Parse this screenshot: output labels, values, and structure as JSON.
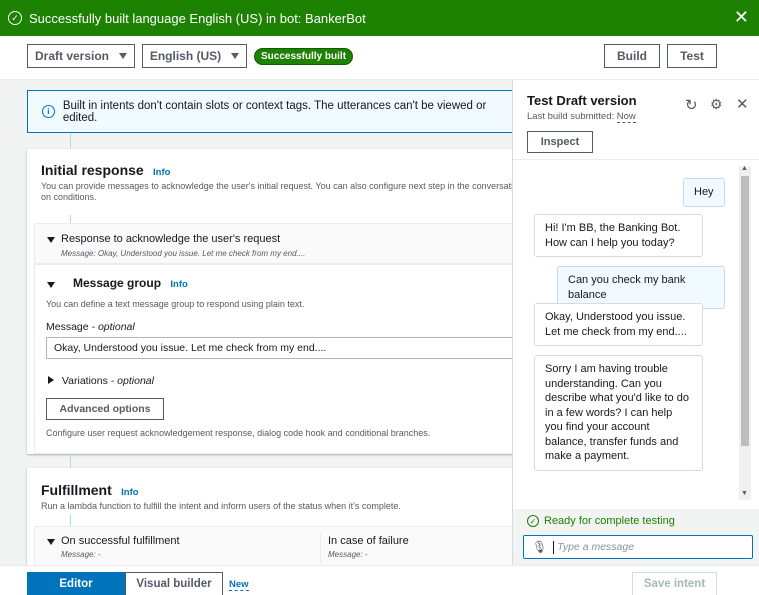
{
  "flash": {
    "message": "Successfully built language English (US) in bot: BankerBot"
  },
  "toolbar": {
    "version": "Draft version",
    "language": "English (US)",
    "status": "Successfully built",
    "build_label": "Build",
    "test_label": "Test"
  },
  "alert": {
    "text": "Built in intents don't contain slots or context tags. The utterances can't be viewed or edited."
  },
  "initial_response": {
    "title": "Initial response",
    "info": "Info",
    "desc_line1": "You can provide messages to acknowledge the user's initial request. You can also configure next step in the conversation a",
    "desc_line2": "on conditions.",
    "ack_title": "Response to acknowledge the user's request",
    "ack_message": "Message: Okay, Understood you issue. Let me check from my end....",
    "group_title": "Message group",
    "group_info": "Info",
    "group_desc": "You can define a text message group to respond using plain text.",
    "message_label": "Message",
    "message_optional": " - optional",
    "message_value": "Okay, Understood you issue. Let me check from my end....",
    "variations_label": "Variations",
    "variations_optional": " - optional",
    "advanced_label": "Advanced options",
    "footer_desc": "Configure user request acknowledgement response, dialog code hook and conditional branches."
  },
  "fulfillment": {
    "title": "Fulfillment",
    "info": "Info",
    "desc": "Run a lambda function to fulfill the intent and inform users of the status when it's complete.",
    "success_title": "On successful fulfillment",
    "success_message": "Message: -",
    "failure_title": "In case of failure",
    "failure_message": "Message: -"
  },
  "test_panel": {
    "title": "Test Draft version",
    "last_build_label": "Last build submitted: ",
    "last_build_value": "Now",
    "inspect_label": "Inspect",
    "messages": [
      {
        "from": "user",
        "text": "Hey"
      },
      {
        "from": "bot",
        "text": "Hi! I'm BB, the Banking Bot. How can I help you today?"
      },
      {
        "from": "user",
        "text": "Can you check my bank balance"
      },
      {
        "from": "bot",
        "text": "Okay, Understood you issue. Let me check from my end...."
      },
      {
        "from": "bot",
        "text": "Sorry I am having trouble understanding. Can you describe what you'd like to do in a few words? I can help you find your account balance, transfer funds and make a payment."
      }
    ],
    "ready_text": "Ready for complete testing",
    "input_placeholder": "Type a message"
  },
  "bottom": {
    "editor_label": "Editor",
    "visual_label": "Visual builder",
    "new_label": "New",
    "save_label": "Save intent"
  },
  "colors": {
    "success": "#1d8102",
    "link": "#0073bb",
    "primary": "#0073bb"
  }
}
